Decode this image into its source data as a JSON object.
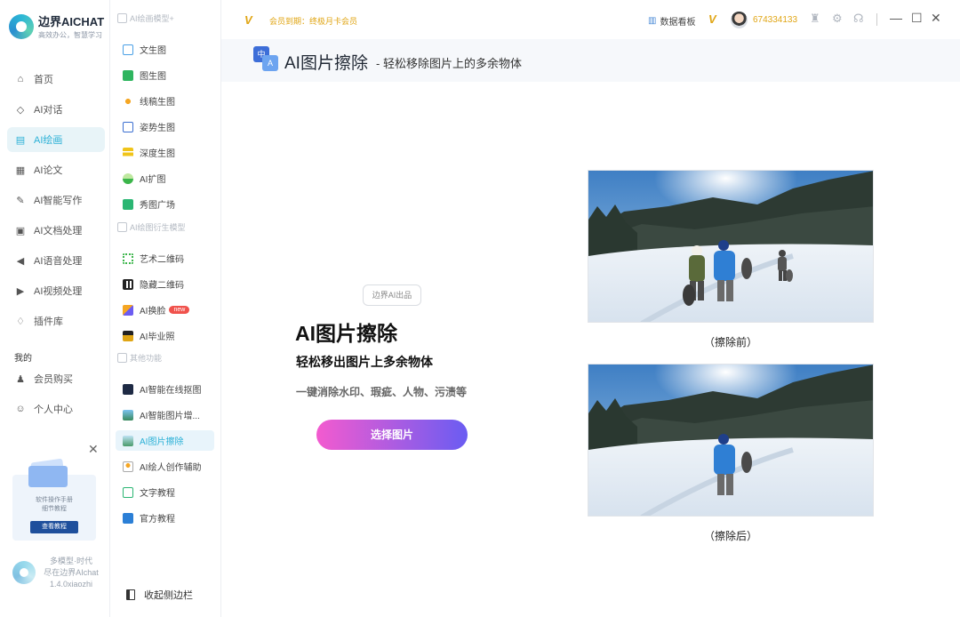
{
  "app": {
    "name": "边界AICHAT",
    "slogan": "高效办公，智慧学习",
    "footer_line1": "多模型·时代",
    "footer_line2": "尽在边界AIchat",
    "version": "1.4.0xiaozhi"
  },
  "sidebar": {
    "items": [
      {
        "label": "首页",
        "icon": "home-icon"
      },
      {
        "label": "AI对话",
        "icon": "cube-icon"
      },
      {
        "label": "AI绘画",
        "icon": "image-icon"
      },
      {
        "label": "AI论文",
        "icon": "document-icon"
      },
      {
        "label": "AI智能写作",
        "icon": "pen-icon"
      },
      {
        "label": "AI文档处理",
        "icon": "text-doc-icon"
      },
      {
        "label": "AI语音处理",
        "icon": "speaker-icon"
      },
      {
        "label": "AI视频处理",
        "icon": "video-icon"
      },
      {
        "label": "插件库",
        "icon": "lightbulb-icon"
      }
    ],
    "section_mine": "我的",
    "mine_items": [
      {
        "label": "会员购买",
        "icon": "user-icon"
      },
      {
        "label": "个人中心",
        "icon": "person-icon"
      }
    ],
    "promo": {
      "line1": "软件操作手册",
      "line2": "细节教程",
      "button": "查看教程"
    }
  },
  "subbar": {
    "sections": [
      {
        "title": "AI绘画模型+"
      },
      {
        "title": "AI绘图衍生模型"
      },
      {
        "title": "其他功能"
      }
    ],
    "group1": [
      "文生图",
      "图生图",
      "线稿生图",
      "姿势生图",
      "深度生图",
      "AI扩图",
      "秀图广场"
    ],
    "group2": [
      "艺术二维码",
      "隐藏二维码",
      "AI换脸",
      "AI毕业照"
    ],
    "new_badge": "new",
    "group3": [
      "AI智能在线抠图",
      "AI智能图片增...",
      "AI图片擦除",
      "AI绘人创作辅助",
      "文字教程",
      "官方教程"
    ],
    "collapse_label": "收起侧边栏"
  },
  "topbar": {
    "vip_label": "会员到期：终极月卡会员",
    "dashboard_label": "数据看板",
    "user_id": "674334133"
  },
  "page": {
    "icon_a": "中",
    "icon_b": "A",
    "title": "AI图片擦除",
    "subtitle": "- 轻松移除图片上的多余物体",
    "tag": "边界AI出品",
    "hero_title": "AI图片擦除",
    "hero_sub": "轻松移出图片上多余物体",
    "hero_desc": "一键消除水印、瑕疵、人物、污渍等",
    "cta": "选择图片",
    "before_caption": "（擦除前）",
    "after_caption": "（擦除后）"
  },
  "colors": {
    "accent": "#2ab0d6",
    "vip_gold": "#e0a514",
    "cta_start": "#f35bcf",
    "cta_end": "#6a5cf2"
  }
}
